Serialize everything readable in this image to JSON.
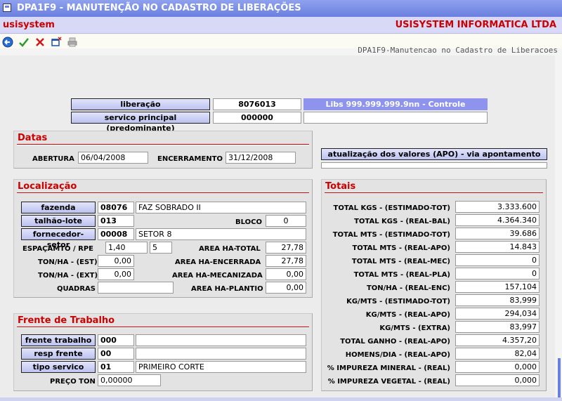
{
  "window": {
    "title": "DPA1F9 - MANUTENÇÃO NO CADASTRO DE LIBERAÇÕES"
  },
  "app": {
    "name": "usisystem",
    "company": "USISYSTEM INFORMATICA LTDA"
  },
  "screen_subtitle": "DPA1F9-Manutencao no Cadastro de Liberacoes",
  "toolbar": {
    "icons": [
      "back-icon",
      "confirm-check-icon",
      "cancel-x-icon",
      "new-window-icon",
      "print-icon"
    ]
  },
  "header": {
    "liberacao_label": "liberação",
    "liberacao_value": "8076013",
    "libs_info": "Libs 999.999.999.9nn - Controle",
    "servico_label": "servico principal (predominante)",
    "servico_value": "000000",
    "servico_desc": ""
  },
  "datas": {
    "title": "Datas",
    "abertura_label": "ABERTURA",
    "abertura_value": "06/04/2008",
    "encerramento_label": "ENCERRAMENTO",
    "encerramento_value": "31/12/2008"
  },
  "apontamento": {
    "button_label": "atualização dos valores (APO) - via apontamento",
    "status": ""
  },
  "localizacao": {
    "title": "Localização",
    "fazenda_label": "fazenda",
    "fazenda_code": "08076",
    "fazenda_name": "FAZ SOBRADO II",
    "talhao_label": "talhão-lote",
    "talhao_code": "013",
    "bloco_label": "BLOCO",
    "bloco_value": "0",
    "fornecedor_label": "fornecedor-setor",
    "fornecedor_code": "00008",
    "fornecedor_name": "SETOR 8",
    "espacamento_label": "ESPAÇAMTO / RPE",
    "espacamento_value": "1,40",
    "rpe_value": "5",
    "area_total_label": "AREA HA-TOTAL",
    "area_total_value": "27,78",
    "ton_est_label": "TON/HA - (EST)",
    "ton_est_value": "0,00",
    "area_encerrada_label": "AREA HA-ENCERRADA",
    "area_encerrada_value": "27,78",
    "ton_ext_label": "TON/HA - (EXT)",
    "ton_ext_value": "0,00",
    "area_mecanizada_label": "AREA HA-MECANIZADA",
    "area_mecanizada_value": "0,00",
    "quadras_label": "QUADRAS",
    "quadras_value": "",
    "area_plantio_label": "AREA HA-PLANTIO",
    "area_plantio_value": "0,00"
  },
  "frente": {
    "title": "Frente de Trabalho",
    "frente_label": "frente trabalho",
    "frente_code": "000",
    "frente_desc": "",
    "resp_label": "resp frente",
    "resp_code": "00",
    "resp_desc": "",
    "tipo_label": "tipo servico",
    "tipo_code": "01",
    "tipo_desc": "PRIMEIRO CORTE",
    "preco_label": "PREÇO TON",
    "preco_value": "0,00000"
  },
  "totais": {
    "title": "Totais",
    "rows": [
      {
        "label": "TOTAL KGS - (ESTIMADO-TOT)",
        "value": "3.333.600"
      },
      {
        "label": "TOTAL KGS - (REAL-BAL)",
        "value": "4.364.340"
      },
      {
        "label": "TOTAL MTS - (ESTIMADO-TOT)",
        "value": "39.686"
      },
      {
        "label": "TOTAL MTS - (REAL-APO)",
        "value": "14.843"
      },
      {
        "label": "TOTAL MTS - (REAL-MEC)",
        "value": "0"
      },
      {
        "label": "TOTAL MTS - (REAL-PLA)",
        "value": "0"
      },
      {
        "label": "TON/HA - (REAL-ENC)",
        "value": "157,104"
      },
      {
        "label": "KG/MTS - (ESTIMADO-TOT)",
        "value": "83,999"
      },
      {
        "label": "KG/MTS - (REAL-APO)",
        "value": "294,034"
      },
      {
        "label": "KG/MTS - (EXTRA)",
        "value": "83,997"
      },
      {
        "label": "TOTAL GANHO - (REAL-APO)",
        "value": "4.357,20"
      },
      {
        "label": "HOMENS/DIA - (REAL-APO)",
        "value": "82,04"
      },
      {
        "label": "% IMPUREZA MINERAL - (REAL)",
        "value": "0,000"
      },
      {
        "label": "% IMPUREZA VEGETAL - (REAL)",
        "value": "0,000"
      }
    ]
  }
}
